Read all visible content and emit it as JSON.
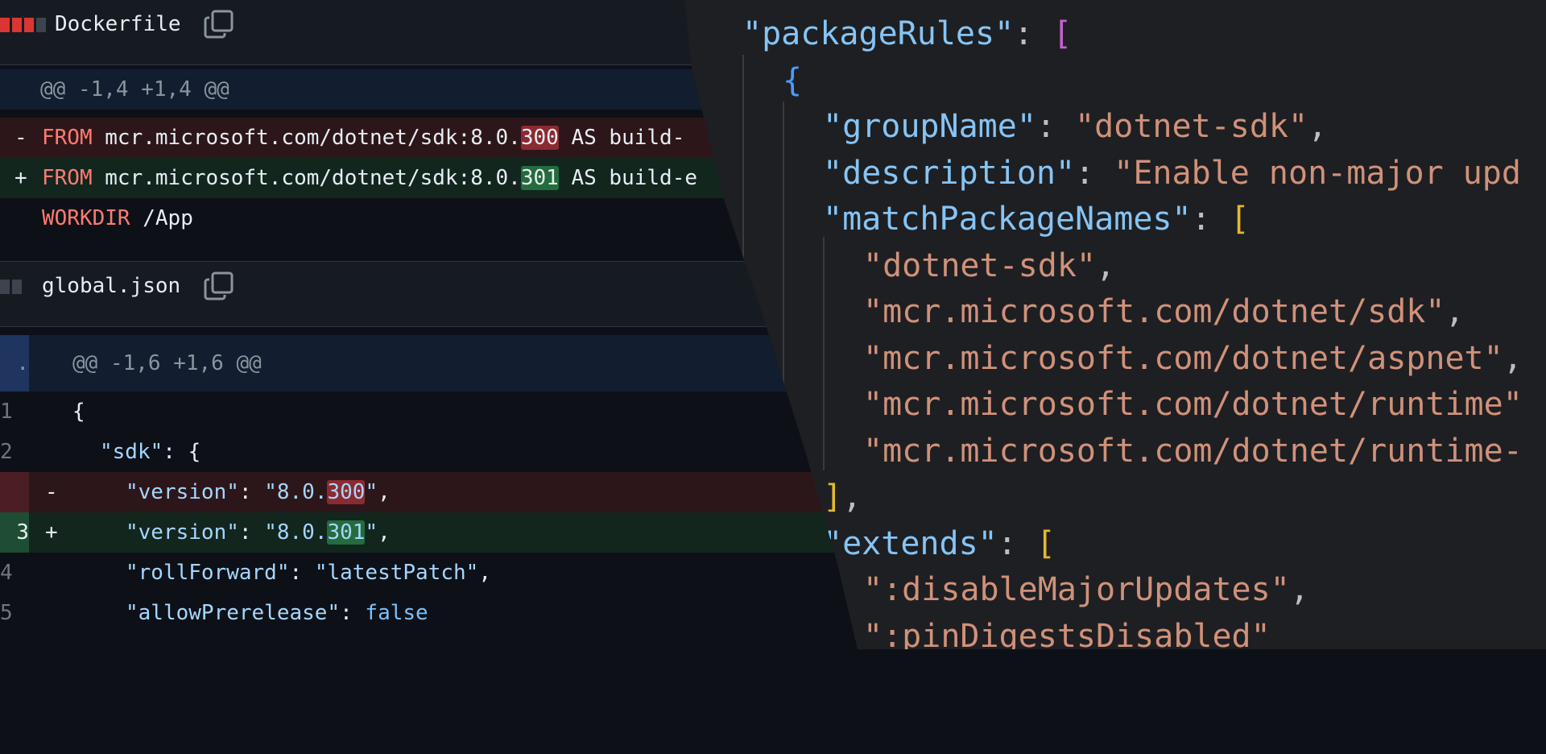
{
  "diff": {
    "files": [
      {
        "name": "Dockerfile",
        "stat": [
          "del",
          "del",
          "del",
          "neu"
        ],
        "hunk": "@@ -1,4 +1,4 @@",
        "lines": [
          {
            "type": "del",
            "sign": "-",
            "kw": "FROM",
            "pre": " mcr.microsoft.com/dotnet/sdk:8.0.",
            "hl": "300",
            "post": " AS build-"
          },
          {
            "type": "add",
            "sign": "+",
            "kw": "FROM",
            "pre": " mcr.microsoft.com/dotnet/sdk:8.0.",
            "hl": "301",
            "post": " AS build-e"
          },
          {
            "type": "ctx",
            "sign": "",
            "kw": "WORKDIR",
            "pre": " /App",
            "hl": "",
            "post": ""
          }
        ]
      },
      {
        "name": "global.json",
        "stat": [
          "neu",
          "neu"
        ],
        "hunk": "@@ -1,6 +1,6 @@",
        "hunk_gutter": ".",
        "lines": [
          {
            "type": "ctx",
            "num": "1",
            "sign": "",
            "text": "{"
          },
          {
            "type": "ctx",
            "num": "2",
            "sign": "",
            "key": "\"sdk\"",
            "rest": ": {"
          },
          {
            "type": "del",
            "num": "",
            "sign": "-",
            "key": "\"version\"",
            "mid": ": ",
            "str_pre": "\"8.0.",
            "hl": "300",
            "str_post": "\"",
            "tail": ","
          },
          {
            "type": "add",
            "num": "3",
            "sign": "+",
            "key": "\"version\"",
            "mid": ": ",
            "str_pre": "\"8.0.",
            "hl": "301",
            "str_post": "\"",
            "tail": ","
          },
          {
            "type": "ctx",
            "num": "4",
            "sign": "",
            "key": "\"rollForward\"",
            "mid": ": ",
            "str_pre": "\"latestPatch\"",
            "hl": "",
            "str_post": "",
            "tail": ","
          },
          {
            "type": "ctx",
            "num": "5",
            "sign": "",
            "key": "\"allowPrerelease\"",
            "mid": ": ",
            "bool": "false"
          }
        ]
      }
    ]
  },
  "editor": {
    "lines": [
      {
        "indent": 0,
        "parts": [
          {
            "c": "jkey",
            "t": "\"packageRules\""
          },
          {
            "c": "jpunc",
            "t": ": "
          },
          {
            "c": "b-pink",
            "t": "["
          }
        ]
      },
      {
        "indent": 1,
        "parts": [
          {
            "c": "b-blue",
            "t": "{"
          }
        ]
      },
      {
        "indent": 2,
        "parts": [
          {
            "c": "jkey",
            "t": "\"groupName\""
          },
          {
            "c": "jpunc",
            "t": ": "
          },
          {
            "c": "jstr",
            "t": "\"dotnet-sdk\""
          },
          {
            "c": "jpunc",
            "t": ","
          }
        ]
      },
      {
        "indent": 2,
        "parts": [
          {
            "c": "jkey",
            "t": "\"description\""
          },
          {
            "c": "jpunc",
            "t": ": "
          },
          {
            "c": "jstr",
            "t": "\"Enable non-major upd"
          }
        ]
      },
      {
        "indent": 2,
        "parts": [
          {
            "c": "jkey",
            "t": "\"matchPackageNames\""
          },
          {
            "c": "jpunc",
            "t": ": "
          },
          {
            "c": "b-gold",
            "t": "["
          }
        ]
      },
      {
        "indent": 3,
        "parts": [
          {
            "c": "jstr",
            "t": "\"dotnet-sdk\""
          },
          {
            "c": "jpunc",
            "t": ","
          }
        ]
      },
      {
        "indent": 3,
        "parts": [
          {
            "c": "jstr",
            "t": "\"mcr.microsoft.com/dotnet/sdk\""
          },
          {
            "c": "jpunc",
            "t": ","
          }
        ]
      },
      {
        "indent": 3,
        "parts": [
          {
            "c": "jstr",
            "t": "\"mcr.microsoft.com/dotnet/aspnet\""
          },
          {
            "c": "jpunc",
            "t": ","
          }
        ]
      },
      {
        "indent": 3,
        "parts": [
          {
            "c": "jstr",
            "t": "\"mcr.microsoft.com/dotnet/runtime\""
          }
        ]
      },
      {
        "indent": 3,
        "parts": [
          {
            "c": "jstr",
            "t": "\"mcr.microsoft.com/dotnet/runtime-"
          }
        ]
      },
      {
        "indent": 2,
        "parts": [
          {
            "c": "b-gold",
            "t": "]"
          },
          {
            "c": "jpunc",
            "t": ","
          }
        ]
      },
      {
        "indent": 2,
        "parts": [
          {
            "c": "jkey",
            "t": "\"extends\""
          },
          {
            "c": "jpunc",
            "t": ": "
          },
          {
            "c": "b-gold",
            "t": "["
          }
        ]
      },
      {
        "indent": 3,
        "parts": [
          {
            "c": "jstr",
            "t": "\":disableMajorUpdates\""
          },
          {
            "c": "jpunc",
            "t": ","
          }
        ]
      },
      {
        "indent": 3,
        "parts": [
          {
            "c": "jstr",
            "t": "\":pinDigestsDisabled\""
          }
        ]
      }
    ]
  },
  "colors": {
    "diff_bg": "#0d1117",
    "del_bg": "#2d1619",
    "add_bg": "#12261e",
    "hunk_bg": "#121d2f",
    "editor_bg": "#1e1f22",
    "json_key": "#86c4f5",
    "json_string": "#d0917a"
  }
}
